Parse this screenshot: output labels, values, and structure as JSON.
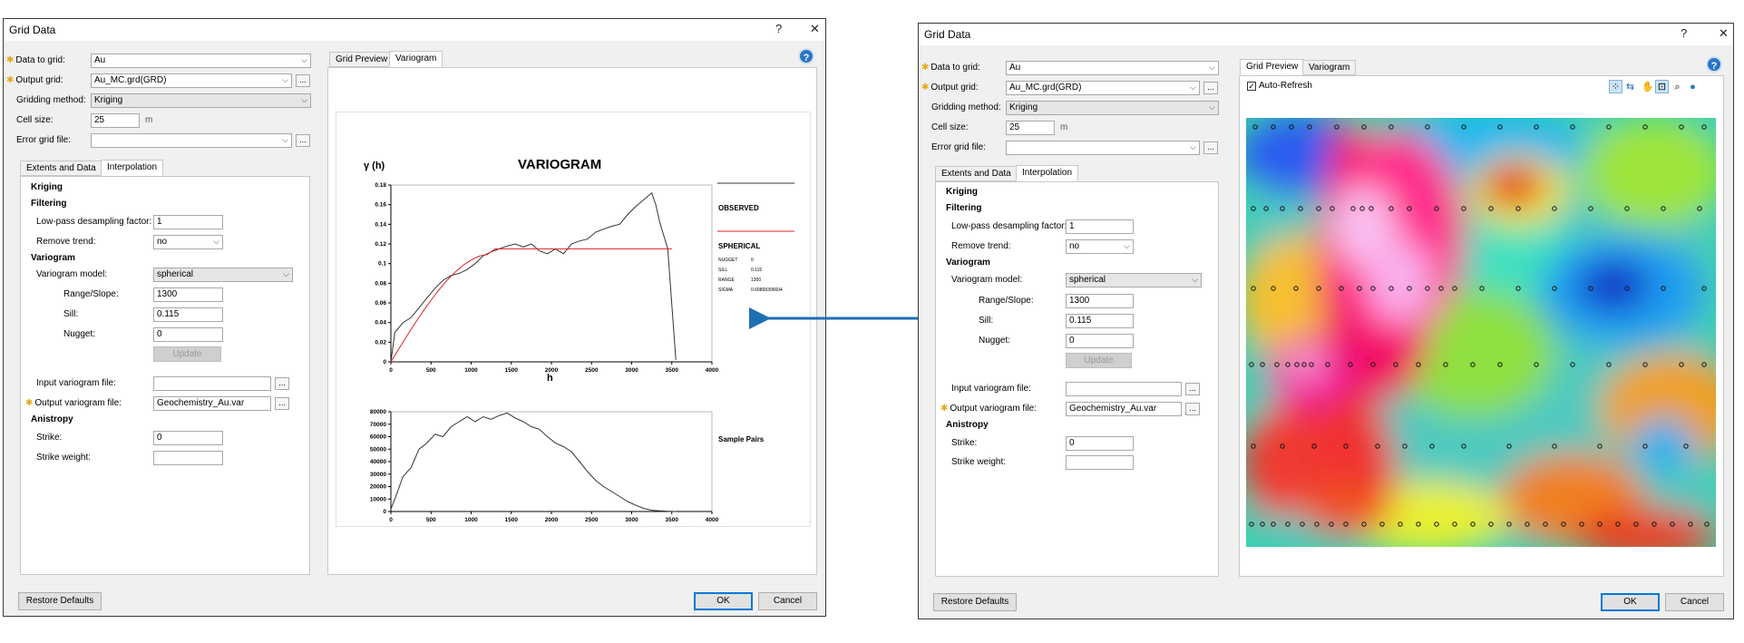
{
  "left_dialog": {
    "title": "Grid Data",
    "help_btn": "?",
    "close_btn": "✕",
    "data_to_grid": {
      "label": "Data to grid:",
      "value": "Au"
    },
    "output_grid": {
      "label": "Output grid:",
      "value": "Au_MC.grd(GRD)"
    },
    "gridding_method": {
      "label": "Gridding method:",
      "value": "Kriging"
    },
    "cell_size": {
      "label": "Cell size:",
      "value": "25",
      "unit": "m"
    },
    "error_grid": {
      "label": "Error grid file:",
      "value": ""
    },
    "tabs": [
      "Extents and Data",
      "Interpolation"
    ],
    "kriging_header": "Kriging",
    "filtering_header": "Filtering",
    "lowpass": {
      "label": "Low-pass desampling factor:",
      "value": "1"
    },
    "remove_trend": {
      "label": "Remove trend:",
      "value": "no"
    },
    "variogram_header": "Variogram",
    "variogram_model": {
      "label": "Variogram model:",
      "value": "spherical"
    },
    "range_slope": {
      "label": "Range/Slope:",
      "value": "1300"
    },
    "sill": {
      "label": "Sill:",
      "value": "0.115"
    },
    "nugget": {
      "label": "Nugget:",
      "value": "0"
    },
    "update_btn": "Update",
    "input_variogram": {
      "label": "Input variogram file:",
      "value": ""
    },
    "output_variogram": {
      "label": "Output variogram file:",
      "value": "Geochemistry_Au.var"
    },
    "anisotropy_header": "Anistropy",
    "strike": {
      "label": "Strike:",
      "value": "0"
    },
    "strike_weight": {
      "label": "Strike weight:",
      "value": ""
    },
    "right_tabs": [
      "Grid Preview",
      "Variogram"
    ],
    "restore_btn": "Restore Defaults",
    "ok_btn": "OK",
    "cancel_btn": "Cancel",
    "ellipsis": "..."
  },
  "variogram_chart": {
    "title": "VARIOGRAM",
    "ylabel": "γ (h)",
    "xlabel": "h",
    "legend": {
      "observed": "OBSERVED",
      "spherical": "SPHERICAL",
      "params": [
        {
          "name": "NUGGET",
          "value": "0"
        },
        {
          "name": "SILL",
          "value": "0.115"
        },
        {
          "name": "RANGE",
          "value": "1300"
        },
        {
          "name": "SIGMA",
          "value": "0.00868306604"
        }
      ]
    },
    "observed_color": "#333333",
    "model_color": "#e02020",
    "pairs_label": "Sample Pairs"
  },
  "chart_data": [
    {
      "type": "line",
      "title": "VARIOGRAM",
      "xlabel": "h",
      "ylabel": "γ (h)",
      "xlim": [
        0,
        4000
      ],
      "ylim": [
        0,
        0.18
      ],
      "x_ticks": [
        0,
        500,
        1000,
        1500,
        2000,
        2500,
        3000,
        3500,
        4000
      ],
      "y_ticks": [
        "0",
        "0.02",
        "0.04",
        "0.06",
        "0.08",
        "0.1",
        "0.12",
        "0.14",
        "0.16",
        "0.18"
      ],
      "series": [
        {
          "name": "OBSERVED",
          "x": [
            0,
            50,
            150,
            250,
            350,
            450,
            550,
            650,
            750,
            850,
            950,
            1050,
            1150,
            1250,
            1350,
            1450,
            1550,
            1650,
            1750,
            1850,
            1950,
            2050,
            2150,
            2250,
            2350,
            2450,
            2550,
            2650,
            2750,
            2850,
            2950,
            3050,
            3150,
            3250,
            3300,
            3350,
            3450,
            3550
          ],
          "y": [
            0,
            0.03,
            0.04,
            0.045,
            0.055,
            0.065,
            0.075,
            0.083,
            0.088,
            0.09,
            0.094,
            0.1,
            0.108,
            0.112,
            0.115,
            0.118,
            0.12,
            0.117,
            0.12,
            0.113,
            0.11,
            0.115,
            0.11,
            0.12,
            0.123,
            0.125,
            0.132,
            0.135,
            0.138,
            0.14,
            0.15,
            0.158,
            0.165,
            0.172,
            0.16,
            0.142,
            0.115,
            0.002
          ]
        },
        {
          "name": "SPHERICAL",
          "x": [
            0,
            100,
            200,
            300,
            400,
            500,
            600,
            700,
            800,
            900,
            1000,
            1100,
            1200,
            1300,
            3500
          ],
          "y": [
            0,
            0.0133,
            0.0264,
            0.0391,
            0.0513,
            0.0628,
            0.0734,
            0.083,
            0.0913,
            0.0983,
            0.1037,
            0.1076,
            0.1093,
            0.115,
            0.115
          ]
        }
      ]
    },
    {
      "type": "line",
      "title": "Sample Pairs",
      "xlim": [
        0,
        4000
      ],
      "ylim": [
        0,
        80000
      ],
      "x_ticks": [
        0,
        500,
        1000,
        1500,
        2000,
        2500,
        3000,
        3500,
        4000
      ],
      "y_ticks": [
        0,
        10000,
        20000,
        30000,
        40000,
        50000,
        60000,
        70000,
        80000
      ],
      "series": [
        {
          "name": "Sample Pairs",
          "x": [
            0,
            50,
            150,
            250,
            350,
            450,
            550,
            650,
            750,
            850,
            950,
            1050,
            1150,
            1250,
            1350,
            1450,
            1550,
            1650,
            1750,
            1850,
            1950,
            2050,
            2150,
            2250,
            2350,
            2450,
            2550,
            2650,
            2750,
            2850,
            2950,
            3050,
            3150,
            3250,
            3350,
            3450,
            3550
          ],
          "y": [
            2000,
            10000,
            28000,
            35000,
            50000,
            55000,
            62000,
            60000,
            68000,
            72000,
            76000,
            72000,
            76000,
            74000,
            77000,
            79000,
            75000,
            72000,
            68000,
            66000,
            60000,
            55000,
            52000,
            48000,
            40000,
            32000,
            25000,
            20000,
            16000,
            12000,
            8000,
            5000,
            2500,
            1000,
            500,
            200,
            0
          ]
        }
      ]
    }
  ],
  "right_dialog": {
    "title": "Grid Data",
    "help_btn": "?",
    "close_btn": "✕",
    "data_to_grid": {
      "label": "Data to grid:",
      "value": "Au"
    },
    "output_grid": {
      "label": "Output grid:",
      "value": "Au_MC.grd(GRD)"
    },
    "gridding_method": {
      "label": "Gridding method:",
      "value": "Kriging"
    },
    "cell_size": {
      "label": "Cell size:",
      "value": "25",
      "unit": "m"
    },
    "error_grid": {
      "label": "Error grid file:",
      "value": ""
    },
    "tabs": [
      "Extents and Data",
      "Interpolation"
    ],
    "kriging_header": "Kriging",
    "filtering_header": "Filtering",
    "lowpass": {
      "label": "Low-pass desampling factor:",
      "value": "1"
    },
    "remove_trend": {
      "label": "Remove trend:",
      "value": "no"
    },
    "variogram_header": "Variogram",
    "variogram_model": {
      "label": "Variogram model:",
      "value": "spherical"
    },
    "range_slope": {
      "label": "Range/Slope:",
      "value": "1300"
    },
    "sill": {
      "label": "Sill:",
      "value": "0.115"
    },
    "nugget": {
      "label": "Nugget:",
      "value": "0"
    },
    "update_btn": "Update",
    "input_variogram": {
      "label": "Input variogram file:",
      "value": ""
    },
    "output_variogram": {
      "label": "Output variogram file:",
      "value": "Geochemistry_Au.var"
    },
    "anisotropy_header": "Anistropy",
    "strike": {
      "label": "Strike:",
      "value": "0"
    },
    "strike_weight": {
      "label": "Strike weight:",
      "value": ""
    },
    "right_tabs": [
      "Grid Preview",
      "Variogram"
    ],
    "auto_refresh": {
      "label": "Auto-Refresh",
      "checked": true
    },
    "toolbar_icons": [
      "points-icon",
      "pan-arrows-icon",
      "hand-icon",
      "zoom-box-icon",
      "magnify-icon",
      "globe-icon"
    ],
    "restore_btn": "Restore Defaults",
    "ok_btn": "OK",
    "cancel_btn": "Cancel",
    "ellipsis": "..."
  },
  "arrow_color": "#1f6fb5"
}
